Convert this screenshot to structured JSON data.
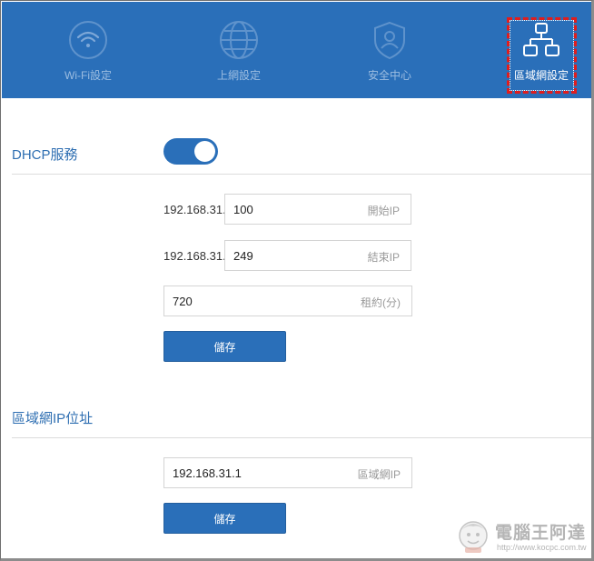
{
  "nav": {
    "items": [
      {
        "label": "Wi-Fi設定",
        "icon": "wifi-icon"
      },
      {
        "label": "上網設定",
        "icon": "globe-icon"
      },
      {
        "label": "安全中心",
        "icon": "shield-user-icon"
      },
      {
        "label": "區域網設定",
        "icon": "network-icon",
        "active": true
      }
    ]
  },
  "dhcp": {
    "title": "DHCP服務",
    "enabled": true,
    "ip_prefix": "192.168.31.",
    "start": {
      "value": "100",
      "hint": "開始IP"
    },
    "end": {
      "value": "249",
      "hint": "結束IP"
    },
    "lease": {
      "value": "720",
      "hint": "租約(分)"
    },
    "save_label": "儲存"
  },
  "lan": {
    "title": "區域網IP位址",
    "ip": {
      "value": "192.168.31.1",
      "hint": "區域網IP"
    },
    "save_label": "儲存"
  },
  "watermark": {
    "title": "電腦王阿達",
    "url": "http://www.kocpc.com.tw"
  },
  "colors": {
    "accent": "#2a6fb9",
    "highlight": "#e01d1d"
  }
}
